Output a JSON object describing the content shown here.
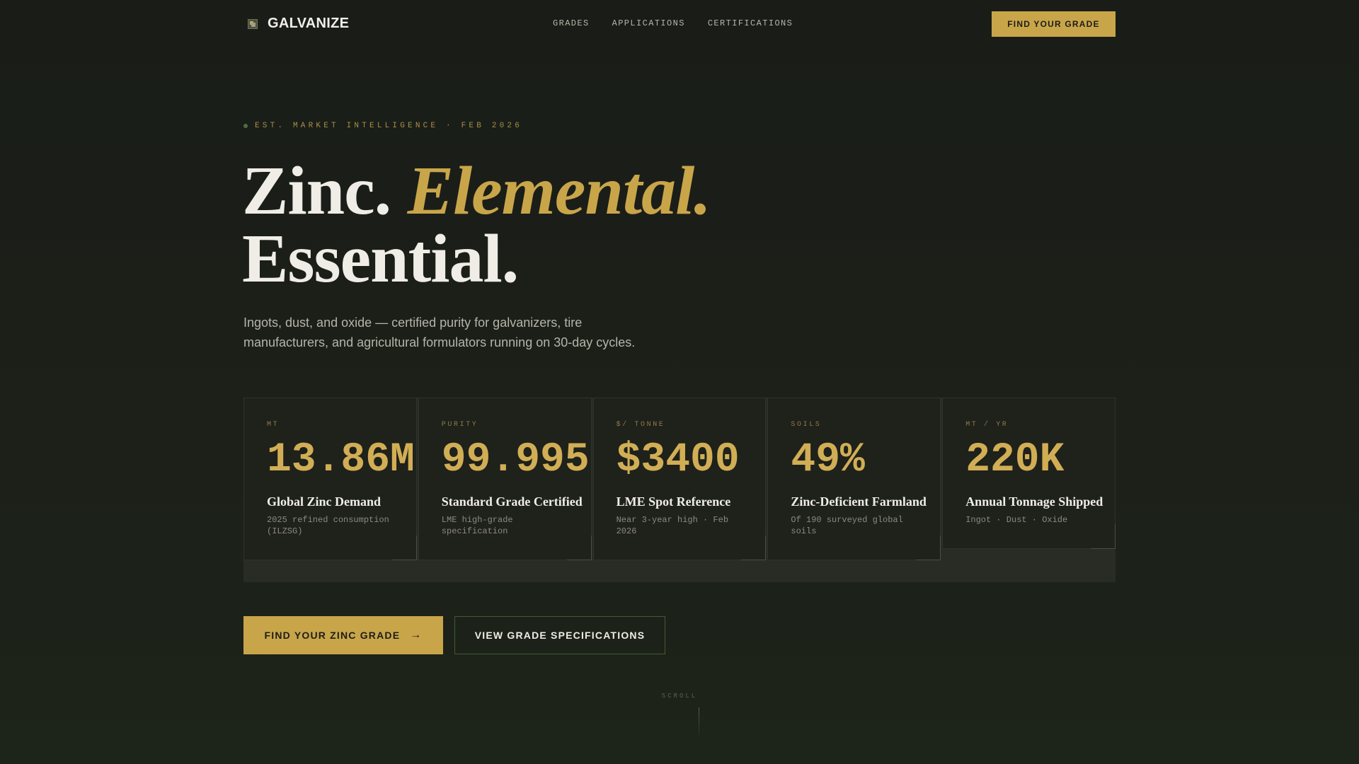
{
  "nav": {
    "brand": "GALVANIZE",
    "links": [
      "GRADES",
      "APPLICATIONS",
      "CERTIFICATIONS"
    ],
    "cta": "FIND YOUR GRADE"
  },
  "hero": {
    "eyebrow": "EST. MARKET INTELLIGENCE · FEB 2026",
    "headline_part1": "Zinc.",
    "headline_accent": "Elemental.",
    "headline_part2": "Essential.",
    "subhead": "Ingots, dust, and oxide — certified purity for galvanizers, tire manufacturers, and agricultural formulators running on 30-day cycles."
  },
  "stats": [
    {
      "label": "MT",
      "value": "13.86M",
      "title": "Global Zinc Demand",
      "desc": "2025 refined consumption (ILZSG)"
    },
    {
      "label": "PURITY",
      "value": "99.995",
      "title": "Standard Grade Certified",
      "desc": "LME high-grade specification"
    },
    {
      "label": "$/ TONNE",
      "value": "$3400",
      "title": "LME Spot Reference",
      "desc": "Near 3-year high · Feb 2026"
    },
    {
      "label": "SOILS",
      "value": "49%",
      "title": "Zinc-Deficient Farmland",
      "desc": "Of 190 surveyed global soils"
    },
    {
      "label": "MT / YR",
      "value": "220K",
      "title": "Annual Tonnage Shipped",
      "desc": "Ingot · Dust · Oxide"
    }
  ],
  "actions": {
    "primary": "FIND YOUR ZINC GRADE",
    "secondary": "VIEW GRADE SPECIFICATIONS"
  },
  "scroll_label": "SCROLL",
  "colors": {
    "background": "#1b1e18",
    "accent_gold": "#c9a54a",
    "text_light": "#efede6",
    "border_green": "#3f5a35"
  },
  "icons": {
    "brand": "galvanize-logo-icon",
    "primary_arrow": "arrow-right-icon"
  }
}
